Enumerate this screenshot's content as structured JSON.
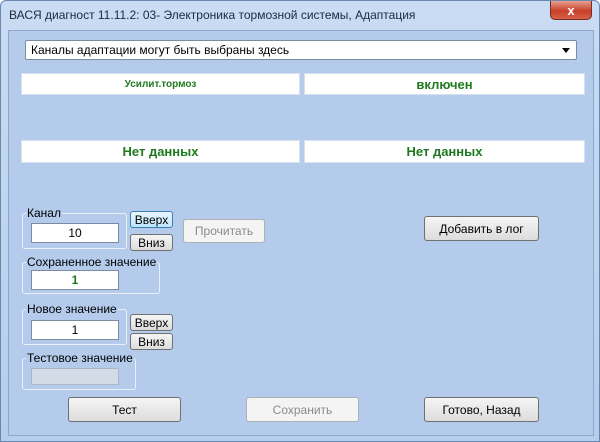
{
  "window": {
    "title": "ВАСЯ диагност 11.11.2: 03- Электроника тормозной системы, Адаптация",
    "close_label": "x"
  },
  "channel_select": {
    "value": "Каналы адаптации могут быть выбраны здесь"
  },
  "panels": {
    "row1_left": "Усилит.тормоз",
    "row1_right": "включен",
    "row2_left": "Нет данных",
    "row2_right": "Нет данных"
  },
  "channel_group": {
    "label": "Канал",
    "value": "10",
    "up_label": "Вверх",
    "down_label": "Вниз"
  },
  "read_button": "Прочитать",
  "add_log_button": "Добавить в лог",
  "saved_group": {
    "label": "Сохраненное значение",
    "value": "1"
  },
  "new_group": {
    "label": "Новое значение",
    "value": "1",
    "up_label": "Вверх",
    "down_label": "Вниз"
  },
  "test_group": {
    "label": "Тестовое значение",
    "value": ""
  },
  "bottom_buttons": {
    "test": "Тест",
    "save": "Сохранить",
    "done": "Готово, Назад"
  }
}
